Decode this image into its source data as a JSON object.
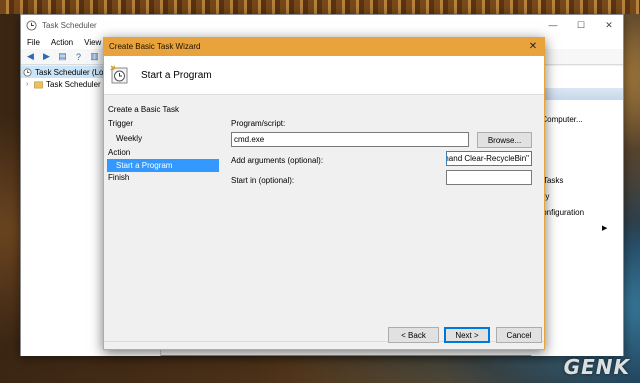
{
  "main_window": {
    "title": "Task Scheduler",
    "controls": {
      "minimize": "—",
      "maximize": "☐",
      "close": "✕"
    },
    "menu": [
      "File",
      "Action",
      "View"
    ],
    "tree": {
      "root_label": "Task Scheduler (Loc",
      "child_label": "Task Scheduler L"
    },
    "actions_fragments": [
      "er Computer...",
      "ng Tasks",
      "story",
      "t Configuration"
    ]
  },
  "wizard": {
    "title": "Create Basic Task Wizard",
    "close_glyph": "✕",
    "heading": "Start a Program",
    "steps": [
      {
        "label": "Create a Basic Task",
        "sub": false,
        "active": false
      },
      {
        "label": "Trigger",
        "sub": false,
        "active": false
      },
      {
        "label": "Weekly",
        "sub": true,
        "active": false
      },
      {
        "label": "Action",
        "sub": false,
        "active": false
      },
      {
        "label": "Start a Program",
        "sub": true,
        "active": true
      },
      {
        "label": "Finish",
        "sub": false,
        "active": false
      }
    ],
    "form": {
      "program_label": "Program/script:",
      "program_value": "cmd.exe",
      "browse_label": "Browse...",
      "arguments_label": "Add arguments (optional):",
      "arguments_value": "mand Clear-RecycleBin\"",
      "start_in_label": "Start in (optional):",
      "start_in_value": ""
    },
    "buttons": {
      "back": "< Back",
      "next": "Next >",
      "cancel": "Cancel"
    }
  },
  "watermark": "GENK",
  "colors": {
    "wizard_frame": "#e8a33c",
    "selection": "#3399ff",
    "default_button_border": "#0078d7"
  }
}
